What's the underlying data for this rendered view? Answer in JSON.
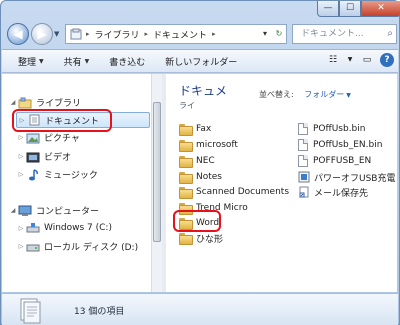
{
  "address": {
    "crumbs": [
      "ライブラリ",
      "ドキュメント"
    ],
    "search_placeholder": "ドキュメント..."
  },
  "toolbar": {
    "organize": "整理",
    "share": "共有",
    "burn": "書き込む",
    "new_folder": "新しいフォルダー"
  },
  "nav": {
    "libraries": "ライブラリ",
    "documents": "ドキュメント",
    "pictures": "ピクチャ",
    "videos": "ビデオ",
    "music": "ミュージック",
    "computer": "コンピューター",
    "drive_c": "Windows 7 (C:)",
    "drive_d": "ローカル ディスク (D:)"
  },
  "content": {
    "library_title": "ドキュメ",
    "library_sub": "ライ",
    "arrange_label": "並べ替え:",
    "arrange_value": "フォルダー",
    "col1": [
      "Fax",
      "microsoft",
      "NEC",
      "Notes",
      "Scanned Documents",
      "Trend Micro",
      "Word",
      "ひな形"
    ],
    "col2": [
      "POffUsb.bin",
      "POffUsb_EN.bin",
      "POFFUSB_EN",
      "パワーオフUSB充電",
      "メール保存先"
    ]
  },
  "details": {
    "count": "13 個の項目"
  },
  "highlight_color": "#e8101a"
}
